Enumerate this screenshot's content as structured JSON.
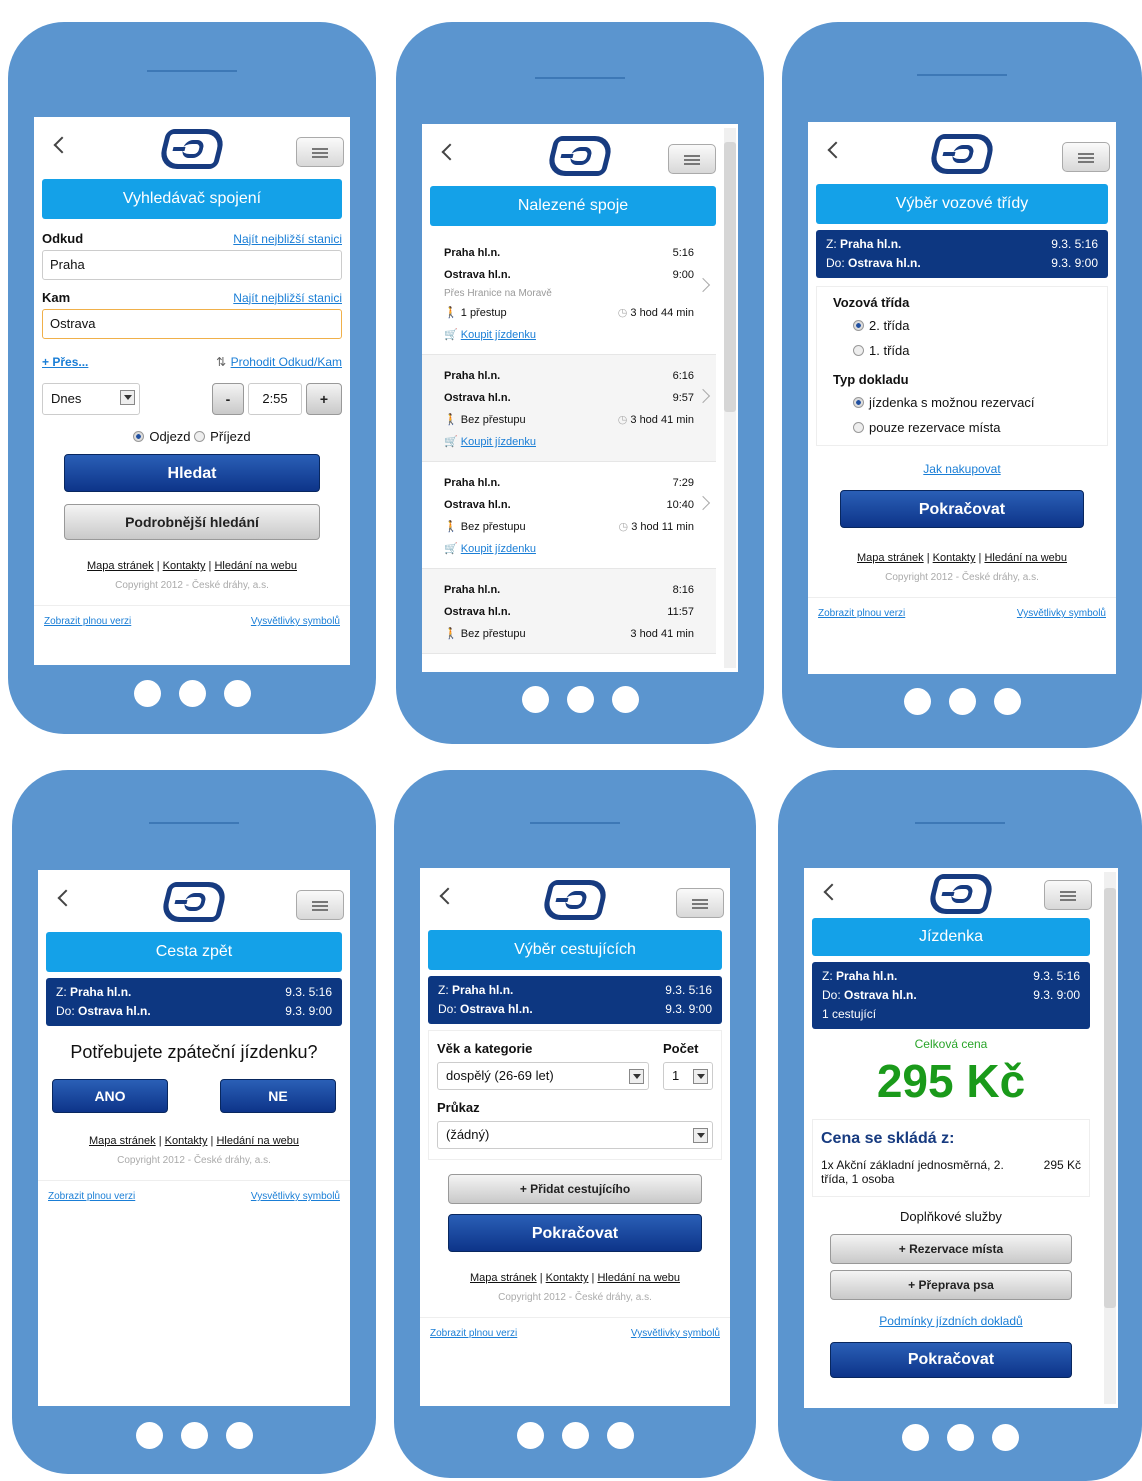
{
  "common": {
    "footer_links": [
      "Mapa stránek",
      "Kontakty",
      "Hledání na webu"
    ],
    "copyright": "Copyright 2012 - České dráhy, a.s.",
    "full_version": "Zobrazit plnou verzi",
    "symbols": "Vysvětlivky symbolů",
    "from_prefix": "Z:",
    "to_prefix": "Do:",
    "from": "Praha hl.n.",
    "to": "Ostrava hl.n.",
    "dep": "9.3. 5:16",
    "arr": "9.3. 9:00",
    "continue": "Pokračovat"
  },
  "s1": {
    "title": "Vyhledávač spojení",
    "from_label": "Odkud",
    "nearest": "Najít nejbližší stanici",
    "from_value": "Praha",
    "to_label": "Kam",
    "to_value": "Ostrava",
    "via": "+ Přes...",
    "swap": "Prohodit Odkud/Kam",
    "date": "Dnes",
    "minus": "-",
    "time": "2:55",
    "plus": "+",
    "dep": "Odjezd",
    "arr": "Příjezd",
    "search": "Hledat",
    "advanced": "Podrobnější hledání"
  },
  "s2": {
    "title": "Nalezené spoje",
    "conns": [
      {
        "from": "Praha hl.n.",
        "t1": "5:16",
        "to": "Ostrava hl.n.",
        "t2": "9:00",
        "via": "Přes Hranice na Moravě",
        "transfers": "1 přestup",
        "dur": "3 hod 44 min",
        "buy": "Koupit jízdenku"
      },
      {
        "from": "Praha hl.n.",
        "t1": "6:16",
        "to": "Ostrava hl.n.",
        "t2": "9:57",
        "via": "",
        "transfers": "Bez přestupu",
        "dur": "3 hod 41 min",
        "buy": "Koupit jízdenku"
      },
      {
        "from": "Praha hl.n.",
        "t1": "7:29",
        "to": "Ostrava hl.n.",
        "t2": "10:40",
        "via": "",
        "transfers": "Bez přestupu",
        "dur": "3 hod 11 min",
        "buy": "Koupit jízdenku"
      },
      {
        "from": "Praha hl.n.",
        "t1": "8:16",
        "to": "Ostrava hl.n.",
        "t2": "11:57",
        "via": "",
        "transfers": "Bez přestupu",
        "dur": "3 hod 41 min",
        "buy": ""
      }
    ]
  },
  "s3": {
    "title": "Výběr vozové třídy",
    "class_label": "Vozová třída",
    "class2": "2. třída",
    "class1": "1. třída",
    "doc_label": "Typ dokladu",
    "doc1": "jízdenka s možnou rezervací",
    "doc2": "pouze rezervace místa",
    "how": "Jak nakupovat"
  },
  "s4": {
    "title": "Cesta zpět",
    "question": "Potřebujete zpáteční jízdenku?",
    "yes": "ANO",
    "no": "NE"
  },
  "s5": {
    "title": "Výběr cestujících",
    "age_label": "Věk a kategorie",
    "count_label": "Počet",
    "age_value": "dospělý (26-69 let)",
    "count_value": "1",
    "card_label": "Průkaz",
    "card_value": "(žádný)",
    "add": "+ Přidat cestujícího"
  },
  "s6": {
    "title": "Jízdenka",
    "passengers": "1 cestující",
    "total_label": "Celková cena",
    "total": "295 Kč",
    "breakdown": "Cena se skládá z:",
    "item": "1x Akční základní jednosměrná, 2. třída, 1 osoba",
    "item_price": "295 Kč",
    "extras": "Doplňkové služby",
    "reserve": "+ Rezervace místa",
    "dog": "+ Přeprava psa",
    "terms": "Podmínky jízdních dokladů"
  }
}
